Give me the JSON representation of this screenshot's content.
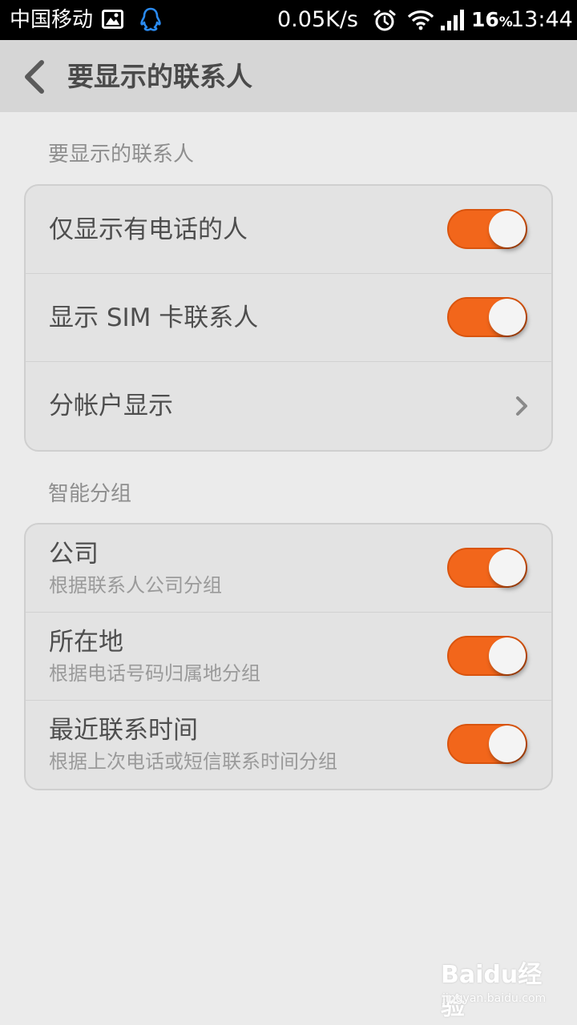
{
  "status_bar": {
    "carrier": "中国移动",
    "speed": "0.05K/s",
    "battery": "16",
    "battery_unit": "%",
    "time": "13:44",
    "icons": [
      "gallery-icon",
      "qq-icon",
      "alarm-icon",
      "wifi-icon",
      "signal-icon"
    ]
  },
  "header": {
    "title": "要显示的联系人"
  },
  "sections": [
    {
      "header": "要显示的联系人",
      "rows": [
        {
          "title": "仅显示有电话的人",
          "control": "toggle",
          "on": true
        },
        {
          "title": "显示 SIM 卡联系人",
          "control": "toggle",
          "on": true
        },
        {
          "title": "分帐户显示",
          "control": "chevron"
        }
      ]
    },
    {
      "header": "智能分组",
      "rows": [
        {
          "title": "公司",
          "subtitle": "根据联系人公司分组",
          "control": "toggle",
          "on": true
        },
        {
          "title": "所在地",
          "subtitle": "根据电话号码归属地分组",
          "control": "toggle",
          "on": true
        },
        {
          "title": "最近联系时间",
          "subtitle": "根据上次电话或短信联系时间分组",
          "control": "toggle",
          "on": true
        }
      ]
    }
  ],
  "watermark": {
    "brand": "Baidu经验",
    "url": "jingyan.baidu.com"
  },
  "colors": {
    "accent": "#f2661b",
    "background": "#ebebeb",
    "action_bar": "#d6d6d6"
  }
}
